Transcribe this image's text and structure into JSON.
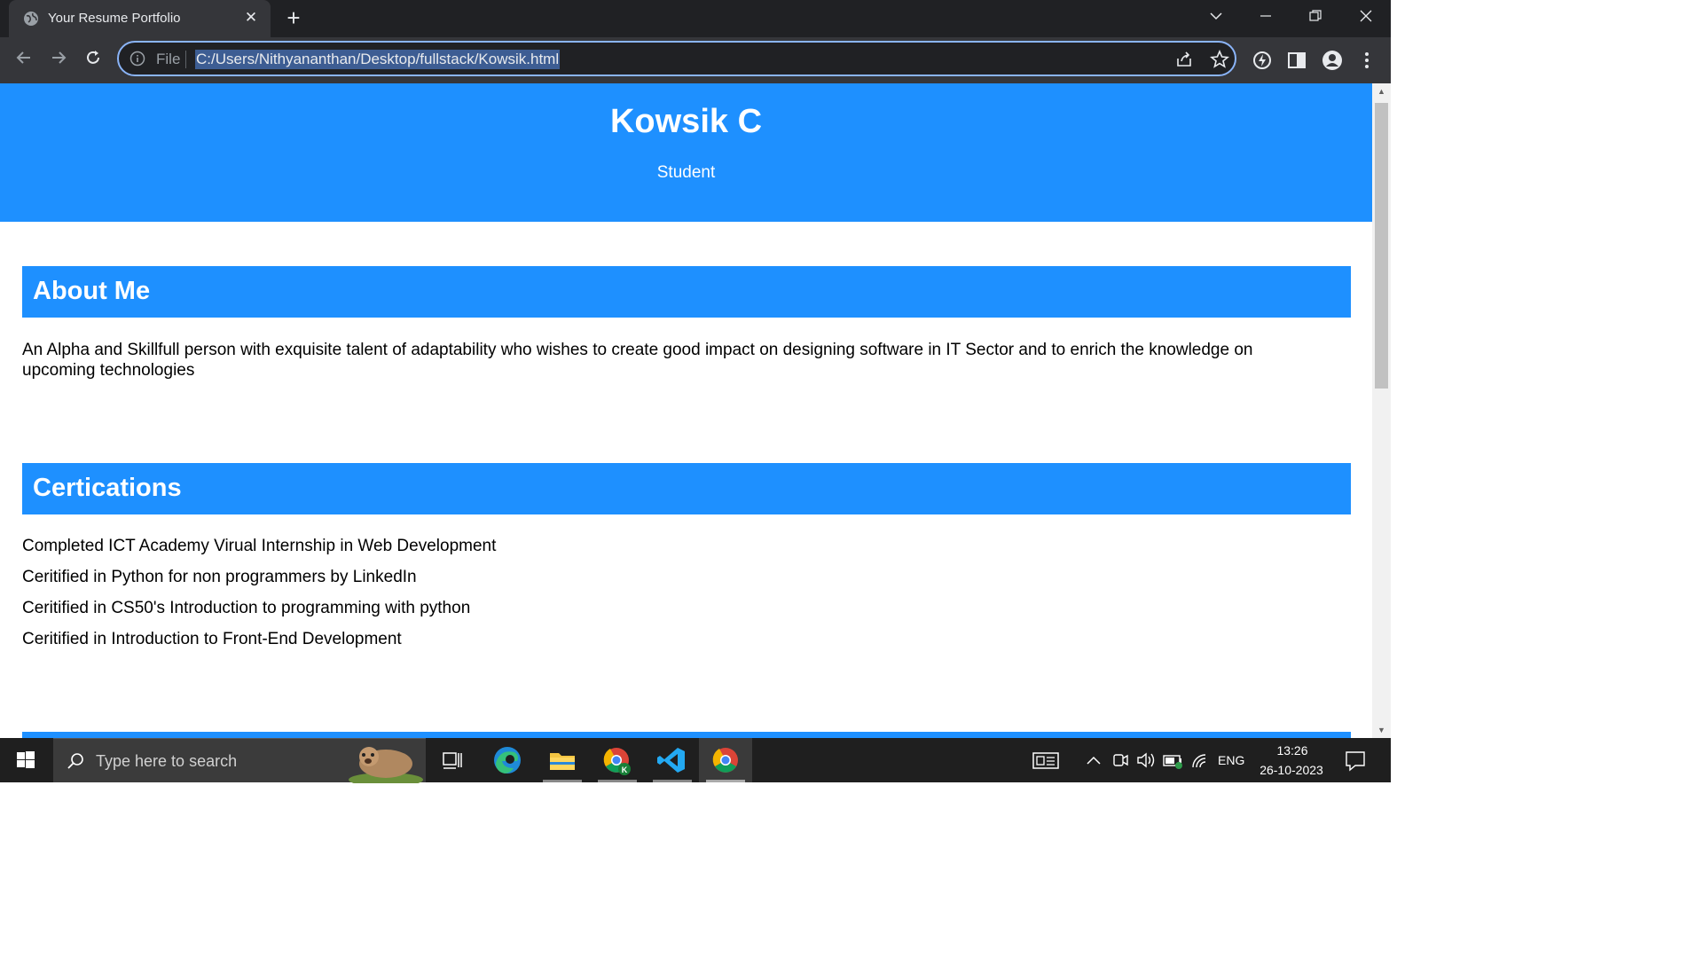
{
  "browser": {
    "tab_title": "Your Resume Portfolio",
    "address_scheme": "File",
    "address_url": "C:/Users/Nithyananthan/Desktop/fullstack/Kowsik.html"
  },
  "page": {
    "name": "Kowsik C",
    "role": "Student",
    "about": {
      "heading": "About Me",
      "text": "An Alpha and Skillfull person with exquisite talent of adaptability who wishes to create good impact on designing software in IT Sector and to enrich the knowledge on upcoming technologies"
    },
    "certifications": {
      "heading": "Certications",
      "items": [
        "Completed ICT Academy Virual Internship in Web Development",
        "Ceritified in Python for non programmers by LinkedIn",
        "Ceritified in CS50's Introduction to programming with python",
        "Ceritified in Introduction to Front-End Development"
      ]
    }
  },
  "taskbar": {
    "search_placeholder": "Type here to search",
    "language": "ENG",
    "time": "13:26",
    "date": "26-10-2023"
  },
  "colors": {
    "accent": "#1e90ff",
    "chrome_dark": "#202124",
    "chrome_toolbar": "#35363a",
    "focus_ring": "#8ab4f8"
  }
}
